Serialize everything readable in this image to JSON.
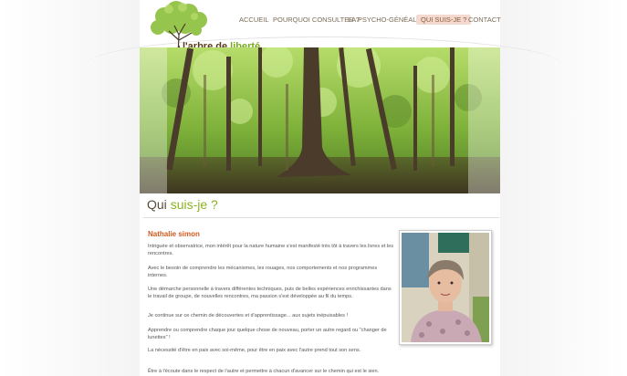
{
  "logo": {
    "text_part1": "l'arbre de ",
    "text_part2": "liberté"
  },
  "nav": [
    {
      "label": "ACCUEIL",
      "active": false
    },
    {
      "label": "POURQUOI CONSULTER ?",
      "active": false
    },
    {
      "label": "LA PSYCHO-GÉNÉALOGIE",
      "active": false
    },
    {
      "label": "QUI SUIS-JE ?",
      "active": true
    },
    {
      "label": "CONTACT",
      "active": false
    }
  ],
  "page": {
    "title_part1": "Qui ",
    "title_part2": "suis-je ?",
    "name": "Nathalie simon",
    "paragraphs": [
      "Intriguée et observatrice, mon intérêt pour la nature humaine s'est manifesté très tôt à travers les livres et les rencontres.",
      "Avec le besoin de comprendre les mécanismes, les rouages, nos comportements et nos programmes internes.",
      "Une démarche personnelle à travers différentes techniques, puis de belles expériences enrichissantes dans le travail de groupe, de nouvelles rencontres, ma passion s'est développée au fil du temps.",
      "Je continue sur ce chemin de découvertes et d'apprentissage... aux sujets inépuisables !",
      "Apprendre ou comprendre chaque jour quelque chose de nouveau, porter un autre regard ou \"changer de lunettes\" !",
      "La nécessité d'être en paix avec soi-même, pour être en paix avec l'autre prend tout son sens.",
      "Être à l'écoute dans le respect de l'autre et permettre à chacun d'avancer sur le chemin qui est le sien."
    ]
  },
  "colors": {
    "accent_green": "#8bb31f",
    "name_orange": "#d05a20",
    "nav_active_bg": "#f3d9cf"
  }
}
